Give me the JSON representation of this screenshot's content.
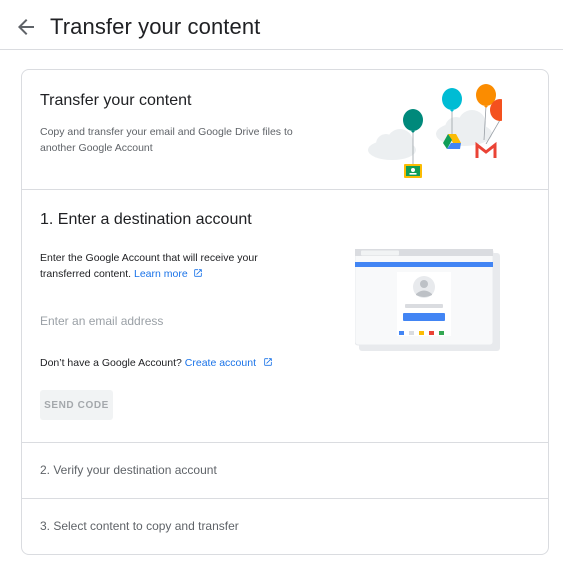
{
  "header": {
    "back_icon": "arrow-left-icon",
    "title": "Transfer your content"
  },
  "intro": {
    "title": "Transfer your content",
    "description": "Copy and transfer your email and Google Drive files to another Google Account",
    "illustration_icons": [
      "balloon-icon",
      "google-classroom-icon",
      "google-drive-icon",
      "gmail-icon",
      "cloud-icon"
    ]
  },
  "step1": {
    "title": "1. Enter a destination account",
    "description": "Enter the Google Account that will receive your transferred content.",
    "learn_more": "Learn more",
    "email_placeholder": "Enter an email address",
    "email_value": "",
    "no_account_text": "Don’t have a Google Account?",
    "create_account": "Create account",
    "send_code": "SEND CODE"
  },
  "step2": {
    "title": "2. Verify your destination account"
  },
  "step3": {
    "title": "3. Select content to copy and transfer"
  },
  "colors": {
    "link": "#1a73e8",
    "border": "#dadce0",
    "muted_text": "#5f6368",
    "google_blue": "#4285f4",
    "google_red": "#ea4335",
    "google_yellow": "#fbbc04",
    "google_green": "#34a853"
  }
}
